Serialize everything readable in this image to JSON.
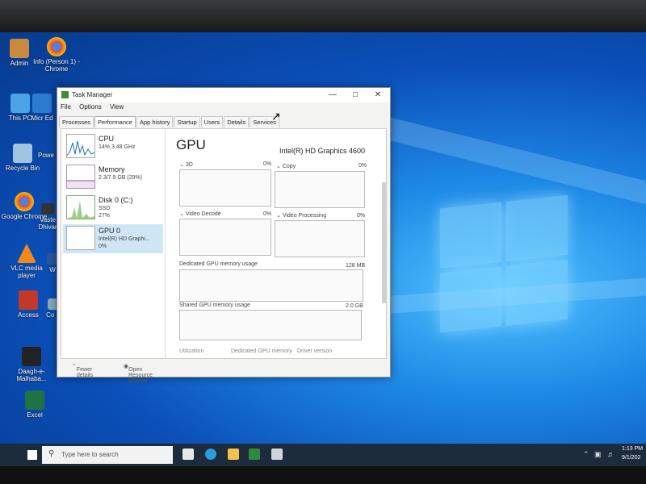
{
  "desktop_icons": [
    {
      "label": "Admin"
    },
    {
      "label": "Info (Person 1) - Chrome"
    },
    {
      "label": "This PC"
    },
    {
      "label": "Micr Ed"
    },
    {
      "label": "Recycle Bin"
    },
    {
      "label": "Powe"
    },
    {
      "label": "Google Chrome"
    },
    {
      "label": "Vaste Dhivar"
    },
    {
      "label": "VLC media player"
    },
    {
      "label": "W"
    },
    {
      "label": "Access"
    },
    {
      "label": "Co P"
    },
    {
      "label": "Daagh-e-Malhaba..."
    },
    {
      "label": "Excel"
    }
  ],
  "task_manager": {
    "title": "Task Manager",
    "menu": [
      "File",
      "Options",
      "View"
    ],
    "tabs": [
      "Processes",
      "Performance",
      "App history",
      "Startup",
      "Users",
      "Details",
      "Services"
    ],
    "active_tab": "Performance",
    "resources": [
      {
        "name": "CPU",
        "line1": "14% 3.48 GHz",
        "line2": ""
      },
      {
        "name": "Memory",
        "line1": "2.3/7.9 GB (29%)",
        "line2": ""
      },
      {
        "name": "Disk 0 (C:)",
        "line1": "SSD",
        "line2": "27%"
      },
      {
        "name": "GPU 0",
        "line1": "Intel(R) HD Graphi...",
        "line2": "0%"
      }
    ],
    "gpu": {
      "title": "GPU",
      "name": "Intel(R) HD Graphics 4600",
      "engines": [
        {
          "label": "3D",
          "value": "0%"
        },
        {
          "label": "Copy",
          "value": "0%"
        },
        {
          "label": "Video Decode",
          "value": "0%"
        },
        {
          "label": "Video Processing",
          "value": "0%"
        }
      ],
      "dedicated_label": "Dedicated GPU memory usage",
      "dedicated_value": "128 MB",
      "shared_label": "Shared GPU memory usage",
      "shared_value": "2.0 GB",
      "stats": [
        "Utilization",
        "Dedicated GPU memory",
        "Driver version"
      ]
    },
    "footer": {
      "fewer": "Fewer details",
      "monitor": "Open Resource Monitor"
    }
  },
  "taskbar": {
    "search_placeholder": "Type here to search",
    "time": "1:13 PM",
    "date": "9/1/202"
  },
  "colors": {
    "accent": "#0078d7",
    "selected": "#cfe6f5"
  }
}
